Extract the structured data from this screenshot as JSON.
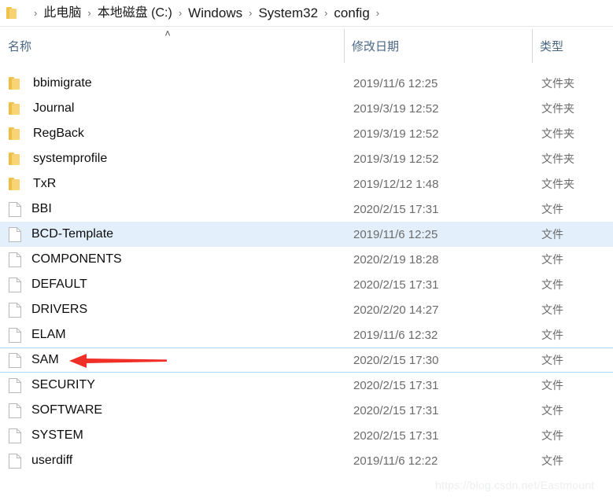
{
  "breadcrumb": {
    "icon": "folder-icon",
    "separator": "›",
    "crumbs": [
      {
        "label": "此电脑",
        "cjk": true
      },
      {
        "label": "本地磁盘 (C:)",
        "cjk": true
      },
      {
        "label": "Windows",
        "cjk": false
      },
      {
        "label": "System32",
        "cjk": false
      },
      {
        "label": "config",
        "cjk": false
      }
    ]
  },
  "columns": {
    "name": "名称",
    "date_modified": "修改日期",
    "type": "类型",
    "sort_caret": "˄"
  },
  "rows": [
    {
      "name": "bbimigrate",
      "date": "2019/11/6 12:25",
      "type": "文件夹",
      "icon": "folder-icon",
      "state": "normal"
    },
    {
      "name": "Journal",
      "date": "2019/3/19 12:52",
      "type": "文件夹",
      "icon": "folder-icon",
      "state": "normal"
    },
    {
      "name": "RegBack",
      "date": "2019/3/19 12:52",
      "type": "文件夹",
      "icon": "folder-icon",
      "state": "normal"
    },
    {
      "name": "systemprofile",
      "date": "2019/3/19 12:52",
      "type": "文件夹",
      "icon": "folder-icon",
      "state": "normal"
    },
    {
      "name": "TxR",
      "date": "2019/12/12 1:48",
      "type": "文件夹",
      "icon": "folder-icon",
      "state": "normal"
    },
    {
      "name": "BBI",
      "date": "2020/2/15 17:31",
      "type": "文件",
      "icon": "file-icon",
      "state": "normal"
    },
    {
      "name": "BCD-Template",
      "date": "2019/11/6 12:25",
      "type": "文件",
      "icon": "file-icon",
      "state": "selected"
    },
    {
      "name": "COMPONENTS",
      "date": "2020/2/19 18:28",
      "type": "文件",
      "icon": "file-icon",
      "state": "normal"
    },
    {
      "name": "DEFAULT",
      "date": "2020/2/15 17:31",
      "type": "文件",
      "icon": "file-icon",
      "state": "normal"
    },
    {
      "name": "DRIVERS",
      "date": "2020/2/20 14:27",
      "type": "文件",
      "icon": "file-icon",
      "state": "normal"
    },
    {
      "name": "ELAM",
      "date": "2019/11/6 12:32",
      "type": "文件",
      "icon": "file-icon",
      "state": "normal"
    },
    {
      "name": "SAM",
      "date": "2020/2/15 17:30",
      "type": "文件",
      "icon": "file-icon",
      "state": "hovered"
    },
    {
      "name": "SECURITY",
      "date": "2020/2/15 17:31",
      "type": "文件",
      "icon": "file-icon",
      "state": "normal"
    },
    {
      "name": "SOFTWARE",
      "date": "2020/2/15 17:31",
      "type": "文件",
      "icon": "file-icon",
      "state": "normal"
    },
    {
      "name": "SYSTEM",
      "date": "2020/2/15 17:31",
      "type": "文件",
      "icon": "file-icon",
      "state": "normal"
    },
    {
      "name": "userdiff",
      "date": "2019/11/6 12:22",
      "type": "文件",
      "icon": "file-icon",
      "state": "normal"
    }
  ],
  "annotation": {
    "arrow_color": "#f03028",
    "arrow_target_row": "SAM",
    "arrow_direction": "left"
  },
  "watermark": {
    "text": "https://blog.csdn.net/Eastmount",
    "color": "#eceef0"
  },
  "colors": {
    "selected_row": "#e3f0fc",
    "hover_border": "#a9d7f5",
    "header_text": "#4a6785",
    "secondary_text": "#6b6b6b",
    "folder_yellow": "#f8d474"
  }
}
